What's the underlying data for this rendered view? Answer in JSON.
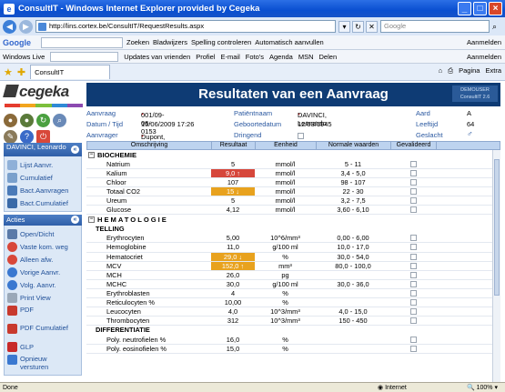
{
  "window": {
    "title": "ConsultIT - Windows Internet Explorer provided by Cegeka",
    "url": "http://lins.cortex.be/ConsultIT/RequestResults.aspx",
    "search_placeholder": "Google"
  },
  "google_toolbar": {
    "logo": "Google",
    "items": [
      "Zoeken",
      "Bladwijzers",
      "Spelling controleren",
      "Automatisch aanvullen",
      "Aanmelden"
    ]
  },
  "links_toolbar": {
    "items": [
      "Windows Live",
      "Updates van vrienden",
      "Profiel",
      "E-mail",
      "Foto's",
      "Agenda",
      "MSN",
      "Delen",
      "Aanmelden"
    ]
  },
  "tabs": {
    "active": "ConsultIT",
    "tools": [
      "Pagina",
      "Extra"
    ]
  },
  "app": {
    "logo": "cegeka",
    "title": "Resultaten van een Aanvraag",
    "version_line1": "DEMOUSER",
    "version_line2": "ConsultIT 2.6"
  },
  "request": {
    "aanvraag_label": "Aanvraag",
    "aanvraag_value": "001/09-06-0153",
    "datum_label": "Datum / Tijd",
    "datum_value": "15/06/2009 17:26",
    "aanvrager_label": "Aanvrager",
    "aanvrager_value": "Dupont, François",
    "patient_label": "Patiëntnaam",
    "patient_value": "DAVINCI, Leonardo",
    "geboorte_label": "Geboortedatum",
    "geboorte_value": "12/03/1945",
    "dringend_label": "Dringend",
    "aard_label": "Aard",
    "aard_value": "A",
    "leeftijd_label": "Leeftijd",
    "leeftijd_value": "64",
    "geslacht_label": "Geslacht",
    "geslacht_value": "♂"
  },
  "sidebar": {
    "patient_panel": {
      "title": "DAVINCI, Leonardo",
      "items": [
        "Lijst Aanvr.",
        "Cumulatief",
        "Bact.Aanvragen",
        "Bact.Cumulatief"
      ]
    },
    "acties_panel": {
      "title": "Acties",
      "items": [
        "Open/Dicht",
        "Vaste kom. weg",
        "Alleen afw.",
        "Vorige Aanvr.",
        "Volg. Aanvr.",
        "Print View",
        "PDF",
        "PDF Cumulatief",
        "GLP",
        "Opnieuw versturen"
      ]
    }
  },
  "table": {
    "headers": [
      "Omschrijving",
      "Resultaat",
      "Eenheid",
      "Normale waarden",
      "Gevalideerd"
    ],
    "biochemie_title": "BIOCHEMIE",
    "biochemie": [
      {
        "name": "Natrium",
        "result": "5",
        "unit": "mmol/l",
        "normal": "5 - 11",
        "flag": ""
      },
      {
        "name": "Kalium",
        "result": "9,0 ↑",
        "unit": "mmol/l",
        "normal": "3,4 - 5,0",
        "flag": "red"
      },
      {
        "name": "Chloor",
        "result": "107",
        "unit": "mmol/l",
        "normal": "98 - 107",
        "flag": ""
      },
      {
        "name": "Totaal CO2",
        "result": "15 ↓",
        "unit": "mmol/l",
        "normal": "22 - 30",
        "flag": "orange"
      },
      {
        "name": "Ureum",
        "result": "5",
        "unit": "mmol/l",
        "normal": "3,2 - 7,5",
        "flag": ""
      },
      {
        "name": "Glucose",
        "result": "4,12",
        "unit": "mmol/l",
        "normal": "3,60 - 6,10",
        "flag": ""
      }
    ],
    "hematologie_title": "HEMATOLOGIE",
    "telling_title": "TELLING",
    "telling": [
      {
        "name": "Erythrocyten",
        "result": "5,00",
        "unit": "10^6/mm³",
        "normal": "0,00 - 6,00",
        "flag": ""
      },
      {
        "name": "Hemoglobine",
        "result": "11,0",
        "unit": "g/100 ml",
        "normal": "10,0 - 17,0",
        "flag": ""
      },
      {
        "name": "Hematocriet",
        "result": "29,0 ↓",
        "unit": "%",
        "normal": "30,0 - 54,0",
        "flag": "orange"
      },
      {
        "name": "MCV",
        "result": "152,0 ↑",
        "unit": "mm³",
        "normal": "80,0 - 100,0",
        "flag": "orange"
      },
      {
        "name": "MCH",
        "result": "26,0",
        "unit": "pg",
        "normal": "",
        "flag": ""
      },
      {
        "name": "MCHC",
        "result": "30,0",
        "unit": "g/100 ml",
        "normal": "30,0 - 36,0",
        "flag": ""
      },
      {
        "name": "Erythroblasten",
        "result": "4",
        "unit": "%",
        "normal": "",
        "flag": ""
      },
      {
        "name": "Reticulocyten %",
        "result": "10,00",
        "unit": "%",
        "normal": "",
        "flag": ""
      },
      {
        "name": "Leucocyten",
        "result": "4,0",
        "unit": "10^3/mm³",
        "normal": "4,0 - 15,0",
        "flag": ""
      },
      {
        "name": "Thrombocyten",
        "result": "312",
        "unit": "10^3/mm³",
        "normal": "150 - 450",
        "flag": ""
      }
    ],
    "differentiatie_title": "DIFFERENTIATIE",
    "differentiatie": [
      {
        "name": "Poly. neutrofielen %",
        "result": "16,0",
        "unit": "%",
        "normal": "",
        "flag": ""
      },
      {
        "name": "Poly. eosinofielen %",
        "result": "15,0",
        "unit": "%",
        "normal": "",
        "flag": ""
      }
    ]
  },
  "status": {
    "left": "Done",
    "zone": "Internet",
    "zoom": "100%"
  },
  "colors": {
    "header_bg": "#0e3b74",
    "flag_red": "#d6473b",
    "flag_orange": "#e8a21e",
    "label_blue": "#2a58a0"
  }
}
